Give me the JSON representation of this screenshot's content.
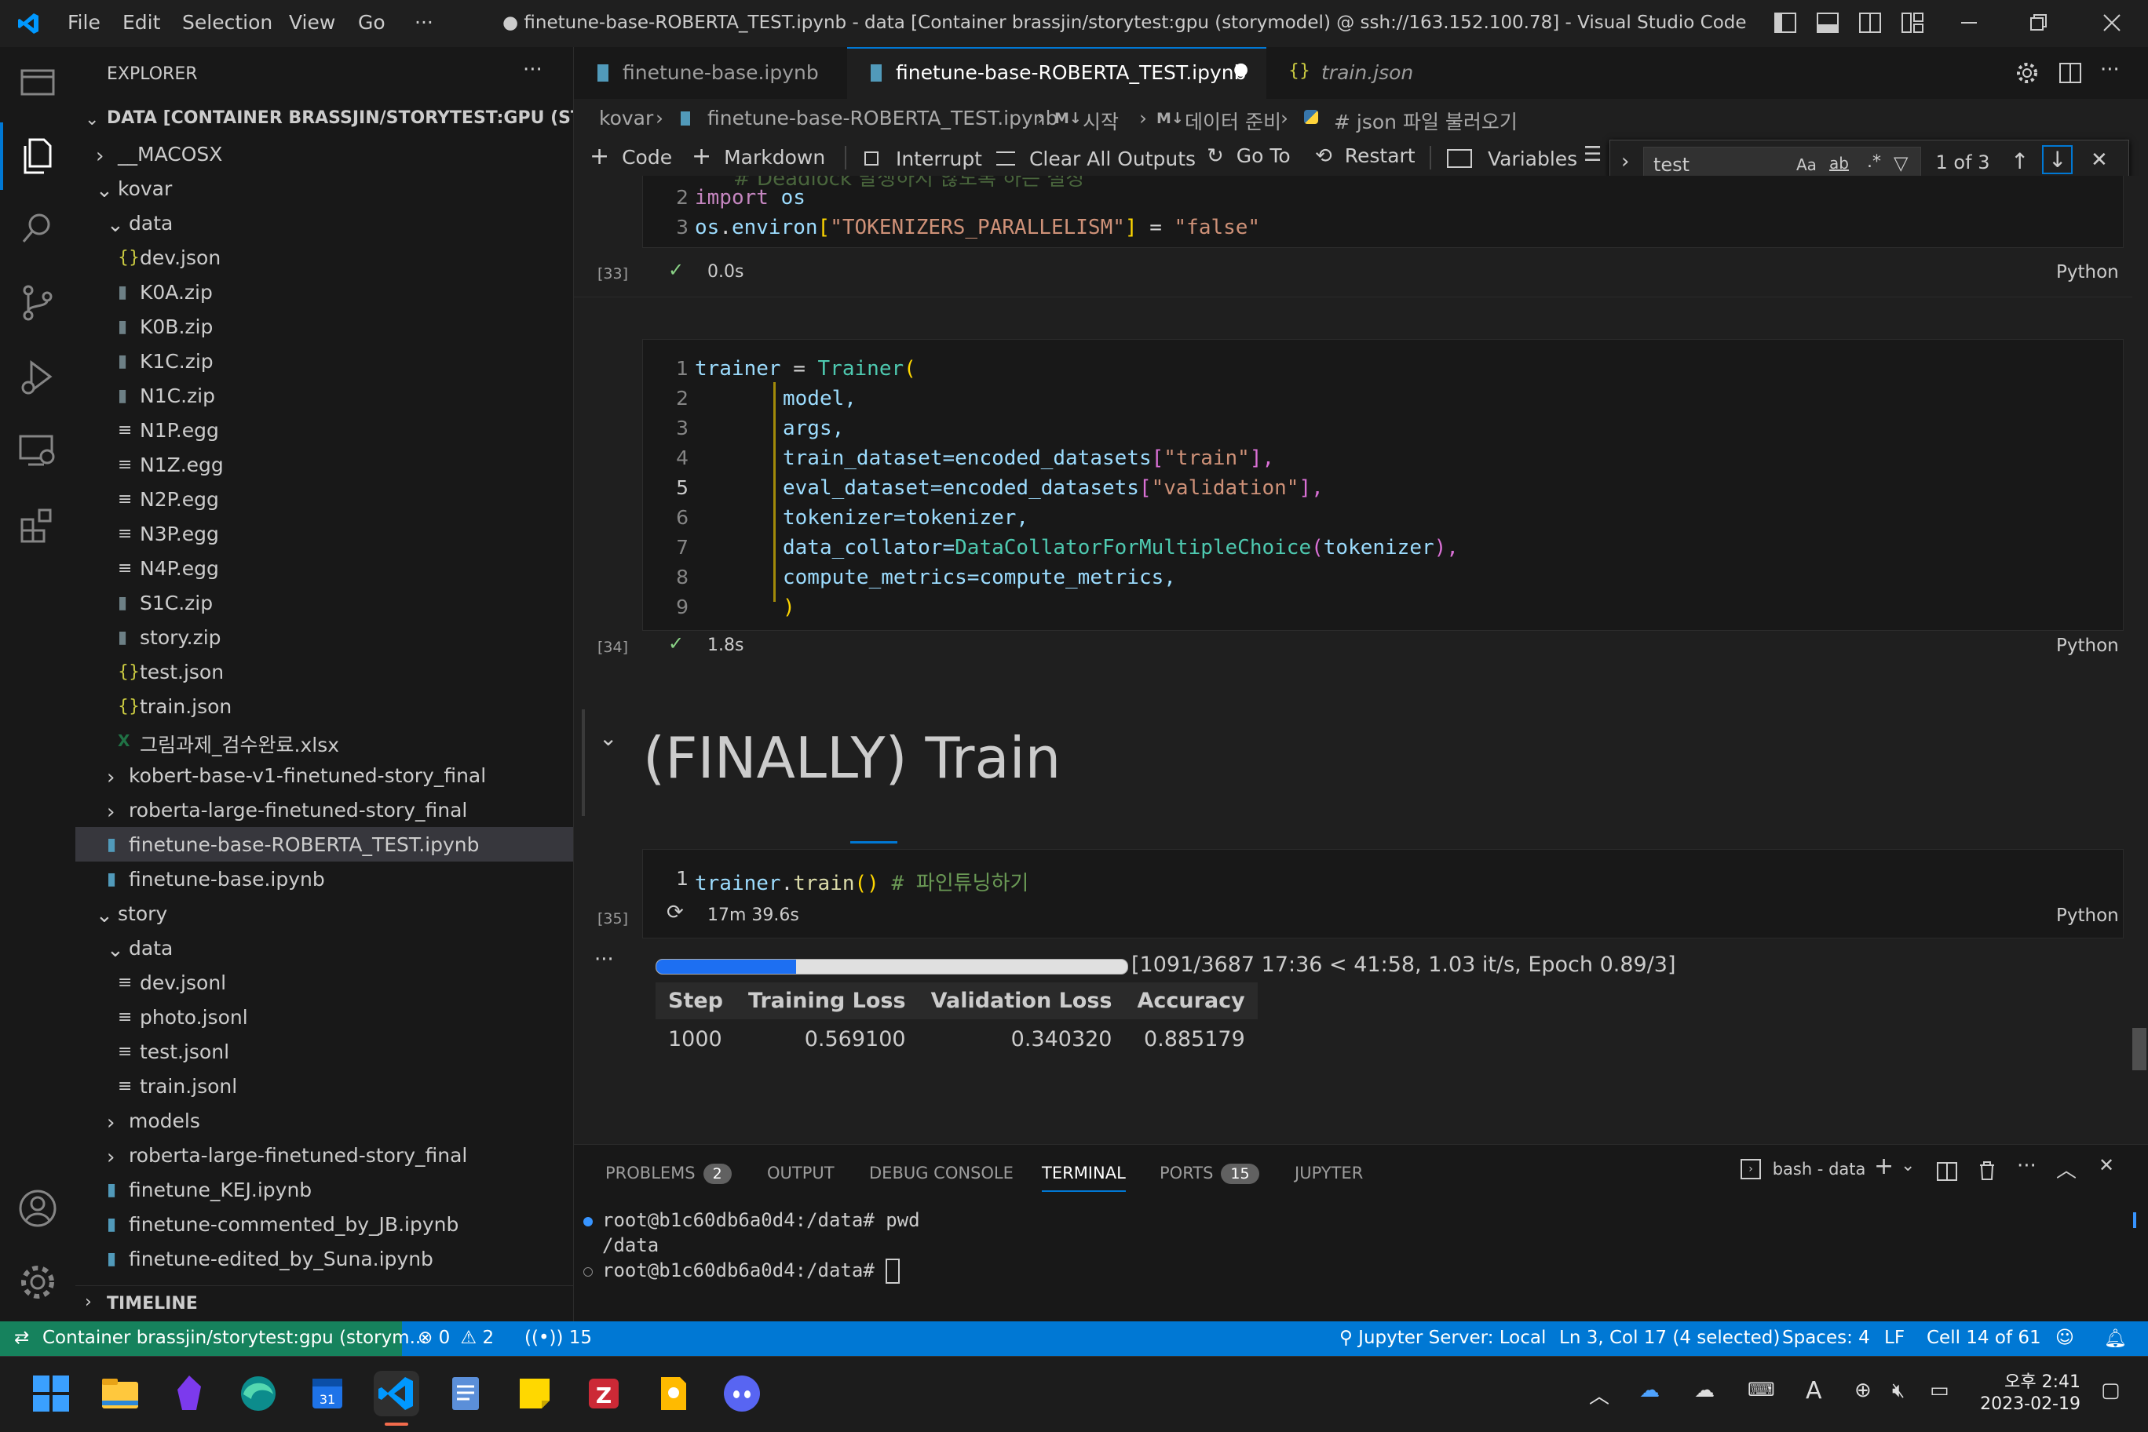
{
  "titlebar": {
    "menu": [
      "File",
      "Edit",
      "Selection",
      "View",
      "Go",
      "···"
    ],
    "window_title": "● finetune-base-ROBERTA_TEST.ipynb - data [Container brassjin/storytest:gpu (storymodel) @ ssh://163.152.100.78] - Visual Studio Code"
  },
  "sidebar": {
    "header": "EXPLORER",
    "more": "···",
    "root": "DATA [CONTAINER BRASSJIN/STORYTEST:GPU (STORY...",
    "items": [
      {
        "label": "__MACOSX",
        "kind": "folder-closed",
        "depth": 1
      },
      {
        "label": "kovar",
        "kind": "folder-open",
        "depth": 1
      },
      {
        "label": "data",
        "kind": "folder-open",
        "depth": 2
      },
      {
        "label": "dev.json",
        "kind": "json",
        "depth": 3
      },
      {
        "label": "K0A.zip",
        "kind": "zip",
        "depth": 3
      },
      {
        "label": "K0B.zip",
        "kind": "zip",
        "depth": 3
      },
      {
        "label": "K1C.zip",
        "kind": "zip",
        "depth": 3
      },
      {
        "label": "N1C.zip",
        "kind": "zip",
        "depth": 3
      },
      {
        "label": "N1P.egg",
        "kind": "text",
        "depth": 3
      },
      {
        "label": "N1Z.egg",
        "kind": "text",
        "depth": 3
      },
      {
        "label": "N2P.egg",
        "kind": "text",
        "depth": 3
      },
      {
        "label": "N3P.egg",
        "kind": "text",
        "depth": 3
      },
      {
        "label": "N4P.egg",
        "kind": "text",
        "depth": 3
      },
      {
        "label": "S1C.zip",
        "kind": "zip",
        "depth": 3
      },
      {
        "label": "story.zip",
        "kind": "zip",
        "depth": 3
      },
      {
        "label": "test.json",
        "kind": "json",
        "depth": 3
      },
      {
        "label": "train.json",
        "kind": "json",
        "depth": 3
      },
      {
        "label": "그림과제_검수완료.xlsx",
        "kind": "xlsx",
        "depth": 3
      },
      {
        "label": "kobert-base-v1-finetuned-story_final",
        "kind": "folder-closed",
        "depth": 2
      },
      {
        "label": "roberta-large-finetuned-story_final",
        "kind": "folder-closed",
        "depth": 2
      },
      {
        "label": "finetune-base-ROBERTA_TEST.ipynb",
        "kind": "notebook",
        "depth": 2,
        "selected": true
      },
      {
        "label": "finetune-base.ipynb",
        "kind": "notebook",
        "depth": 2
      },
      {
        "label": "story",
        "kind": "folder-open",
        "depth": 1
      },
      {
        "label": "data",
        "kind": "folder-open",
        "depth": 2
      },
      {
        "label": "dev.jsonl",
        "kind": "text",
        "depth": 3
      },
      {
        "label": "photo.jsonl",
        "kind": "text",
        "depth": 3
      },
      {
        "label": "test.jsonl",
        "kind": "text",
        "depth": 3
      },
      {
        "label": "train.jsonl",
        "kind": "text",
        "depth": 3
      },
      {
        "label": "models",
        "kind": "folder-closed",
        "depth": 2
      },
      {
        "label": "roberta-large-finetuned-story_final",
        "kind": "folder-closed",
        "depth": 2
      },
      {
        "label": "finetune_KEJ.ipynb",
        "kind": "notebook",
        "depth": 2
      },
      {
        "label": "finetune-commented_by_JB.ipynb",
        "kind": "notebook",
        "depth": 2
      },
      {
        "label": "finetune-edited_by_Suna.ipynb",
        "kind": "notebook",
        "depth": 2
      }
    ],
    "timeline": "TIMELINE"
  },
  "tabs": [
    {
      "label": "finetune-base.ipynb",
      "active": false,
      "italic": false,
      "icon": "notebook-icon"
    },
    {
      "label": "finetune-base-ROBERTA_TEST.ipynb",
      "active": true,
      "italic": false,
      "icon": "notebook-icon",
      "dirty": "●"
    },
    {
      "label": "train.json",
      "active": false,
      "italic": true,
      "icon": "json-icon"
    }
  ],
  "breadcrumb": {
    "items": [
      "kovar",
      "finetune-base-ROBERTA_TEST.ipynb",
      "시작",
      "데이터 준비",
      "# json 파일 불러오기"
    ],
    "md_marker": "M↓"
  },
  "nbtoolbar": {
    "code": "Code",
    "markdown": "Markdown",
    "interrupt": "Interrupt",
    "clear": "Clear All Outputs",
    "goto": "Go To",
    "restart": "Restart",
    "variables": "Variables"
  },
  "find": {
    "query": "test",
    "case": "Aa",
    "word": "ab",
    "regex": ".*",
    "result": "1 of 3"
  },
  "cells": {
    "cell33": {
      "partial": "# Deadlock 발생하지 않도록 하는 설정",
      "line2_num": "2",
      "line3_num": "3",
      "line2": {
        "kw": "import",
        "mod": " os"
      },
      "line3": {
        "a": "os",
        "b": ".",
        "c": "environ",
        "d": "[",
        "e": "\"TOKENIZERS_PARALLELISM\"",
        "f": "]",
        "g": " = ",
        "h": "\"false\""
      },
      "exec": "[33]",
      "time": "0.0s",
      "lang": "Python"
    },
    "cell34": {
      "nums": [
        "1",
        "2",
        "3",
        "4",
        "5",
        "6",
        "7",
        "8",
        "9"
      ],
      "trainer": "trainer",
      "eq": " = ",
      "cls": "Trainer",
      "l2": "model,",
      "l3": "args,",
      "l4a": "train_dataset=encoded_datasets",
      "l4b": "[",
      "l4c": "\"train\"",
      "l4d": "],",
      "l5a": "eval_dataset=encoded_datasets",
      "l5b": "[",
      "l5c": "\"validation\"",
      "l5d": "],",
      "l6": "tokenizer=tokenizer,",
      "l7a": "data_collator=",
      "l7b": "DataCollatorForMultipleChoice",
      "l7c": "(",
      "l7d": "tokenizer",
      "l7e": "),",
      "l8": "compute_metrics=compute_metrics,",
      "l9": ")",
      "exec": "[34]",
      "time": "1.8s",
      "lang": "Python"
    },
    "heading": "(FINALLY) Train",
    "cell35": {
      "num": "1",
      "code_a": "trainer",
      "code_b": ".",
      "code_c": "train",
      "code_d": "()",
      "comment": " # 파인튜닝하기",
      "exec": "[35]",
      "time": "17m 39.6s",
      "lang": "Python"
    },
    "output": {
      "progress_fraction": 0.2959,
      "progress_text": "[1091/3687 17:36 < 41:58, 1.03 it/s, Epoch 0.89/3]",
      "columns": [
        "Step",
        "Training Loss",
        "Validation Loss",
        "Accuracy"
      ],
      "rows": [
        [
          "1000",
          "0.569100",
          "0.340320",
          "0.885179"
        ]
      ]
    }
  },
  "panel": {
    "tabs": [
      {
        "label": "PROBLEMS",
        "badge": "2"
      },
      {
        "label": "OUTPUT"
      },
      {
        "label": "DEBUG CONSOLE"
      },
      {
        "label": "TERMINAL",
        "active": true
      },
      {
        "label": "PORTS",
        "badge": "15"
      },
      {
        "label": "JUPYTER"
      }
    ],
    "shell": "bash - data",
    "terminal_lines": [
      "root@b1c60db6a0d4:/data# pwd",
      "/data",
      "root@b1c60db6a0d4:/data# "
    ]
  },
  "statusbar": {
    "remote": "Container brassjin/storytest:gpu (storym...",
    "errors": "0",
    "warnings": "2",
    "ports": "15",
    "jupyter": "Jupyter Server: Local",
    "position": "Ln 3, Col 17 (4 selected)",
    "spaces": "Spaces: 4",
    "eol": "LF",
    "cell": "Cell 14 of 61"
  },
  "taskbar": {
    "time": "오후 2:41",
    "date": "2023-02-19",
    "ime": "A"
  },
  "colors": {
    "accent": "#0078d4",
    "remote": "#16825d",
    "success": "#89d185"
  }
}
